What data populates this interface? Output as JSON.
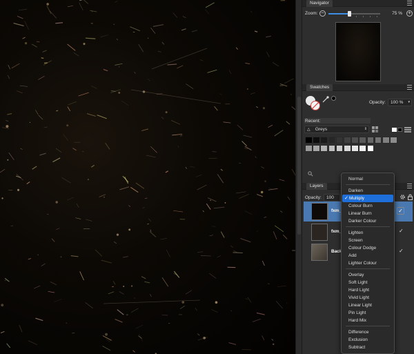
{
  "navigator": {
    "tab": "Navigator",
    "zoom_label": "Zoom:",
    "minus": "−",
    "plus": "+",
    "zoom_value": "75 %",
    "zoom_fraction": 0.4
  },
  "swatches": {
    "tab": "Swatches",
    "opacity_label": "Opacity:",
    "opacity_value": "100 %",
    "recent_label": "Recent:",
    "palette_name": "Greys",
    "palette_rows": [
      [
        "#000000",
        "#0d0d0d",
        "#1a1a1a",
        "#262626",
        "#333333",
        "#404040",
        "#4d4d4d",
        "#595959",
        "#666666",
        "#737373",
        "#808080",
        "#8c8c8c"
      ],
      [
        "#999999",
        "#a6a6a6",
        "#b3b3b3",
        "#bfbfbf",
        "#cccccc",
        "#d9d9d9",
        "#e6e6e6",
        "#f2f2f2",
        "#ffffff"
      ]
    ]
  },
  "layers": {
    "tab": "Layers",
    "opacity_label": "Opacity:",
    "opacity_value": "100 %",
    "items": [
      {
        "name": "fxm_",
        "selected": true
      },
      {
        "name": "fxm_",
        "selected": false
      },
      {
        "name": "Back",
        "selected": false
      }
    ]
  },
  "blend_menu": {
    "groups": [
      [
        "Normal"
      ],
      [
        "Darken",
        "Multiply",
        "Colour Burn",
        "Linear Burn",
        "Darker Colour"
      ],
      [
        "Lighten",
        "Screen",
        "Colour Dodge",
        "Add",
        "Lighter Colour"
      ],
      [
        "Overlay",
        "Soft Light",
        "Hard Light",
        "Vivid Light",
        "Linear Light",
        "Pin Light",
        "Hard Mix"
      ],
      [
        "Difference",
        "Exclusion",
        "Subtract"
      ]
    ],
    "selected": "Multiply",
    "check": "✓"
  },
  "colors": {
    "accent": "#1e6fd9",
    "selected_row": "#4a78b0"
  }
}
